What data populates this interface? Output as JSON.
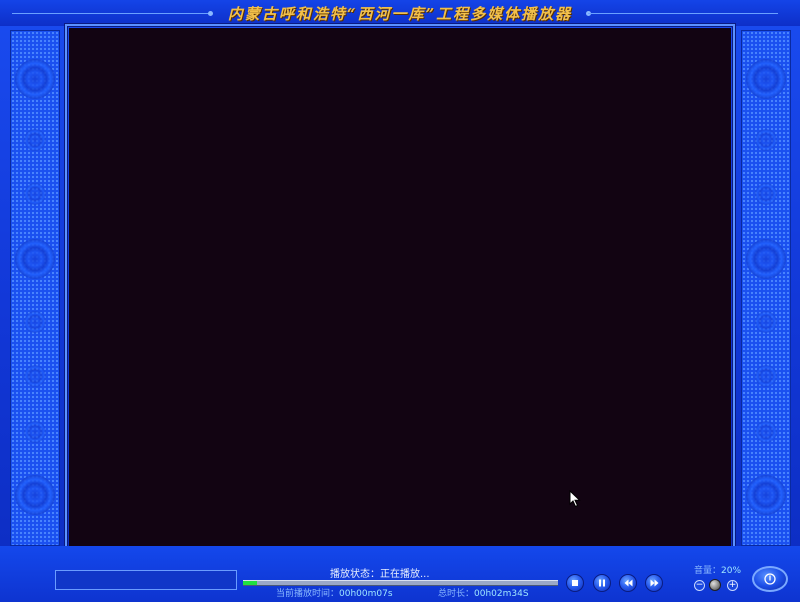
{
  "window": {
    "title": "内蒙古呼和浩特“西河一库”工程多媒体播放器"
  },
  "player": {
    "status_label": "播放状态：",
    "status_value": "正在播放...",
    "current_time_label": "当前播放时间：",
    "current_time_value": "00h00m07s",
    "total_time_label": "总时长：",
    "total_time_value": "00h02m34S",
    "progress_fraction": 0.0455,
    "volume_label": "音量：",
    "volume_value": "20%",
    "volume_minus": "−",
    "volume_plus": "+"
  },
  "icons": {
    "stop": "stop-icon",
    "pause": "pause-icon",
    "rewind": "rewind-icon",
    "fast_forward": "fast-forward-icon",
    "power": "power-icon",
    "cursor": "mouse-cursor-icon"
  },
  "colors": {
    "frame_blue": "#1448ec",
    "title_gold": "#f2c04a",
    "video_bg": "#120412",
    "progress_green": "#20e040",
    "time_value": "#9fe6ff"
  }
}
